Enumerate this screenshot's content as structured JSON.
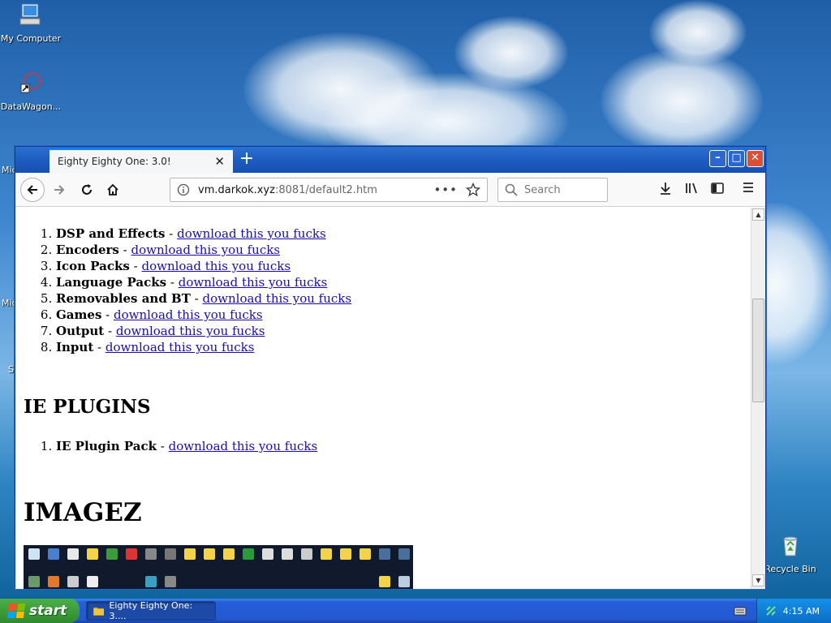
{
  "desktop": {
    "icons": [
      {
        "label": "My Computer"
      },
      {
        "label": "DataWagon..."
      },
      {
        "label": "Recycle Bin"
      }
    ],
    "partial_labels": [
      "Mic",
      "Mic",
      "S"
    ]
  },
  "browser": {
    "tab_title": "Eighty Eighty One: 3.0!",
    "tab_close": "✕",
    "new_tab": "+",
    "url_host": "vm.darkok.xyz",
    "url_path": ":8081/default2.htm",
    "url_more": "•••",
    "search_placeholder": "Search",
    "window_controls": {
      "minimize": "–",
      "maximize": "□",
      "close": "✕"
    }
  },
  "page": {
    "plugins_list": [
      {
        "name": "DSP and Effects",
        "link": "download this you fucks"
      },
      {
        "name": "Encoders",
        "link": "download this you fucks"
      },
      {
        "name": "Icon Packs",
        "link": "download this you fucks"
      },
      {
        "name": "Language Packs",
        "link": "download this you fucks"
      },
      {
        "name": "Removables and BT",
        "link": "download this you fucks"
      },
      {
        "name": "Games",
        "link": "download this you fucks"
      },
      {
        "name": "Output",
        "link": "download this you fucks"
      },
      {
        "name": "Input",
        "link": "download this you fucks"
      }
    ],
    "separator": " - ",
    "ie_heading": "IE PLUGINS",
    "ie_list": [
      {
        "name": "IE Plugin Pack",
        "link": "download this you fucks"
      }
    ],
    "images_heading": "IMAGEZ"
  },
  "taskbar": {
    "start_label": "start",
    "task_label": "Eighty Eighty One: 3....",
    "clock": "4:15 AM"
  },
  "colors": {
    "link": "#1a0dab",
    "titlebar": "#1d5cc0",
    "taskbar": "#245edb",
    "start": "#3c9c3b"
  }
}
